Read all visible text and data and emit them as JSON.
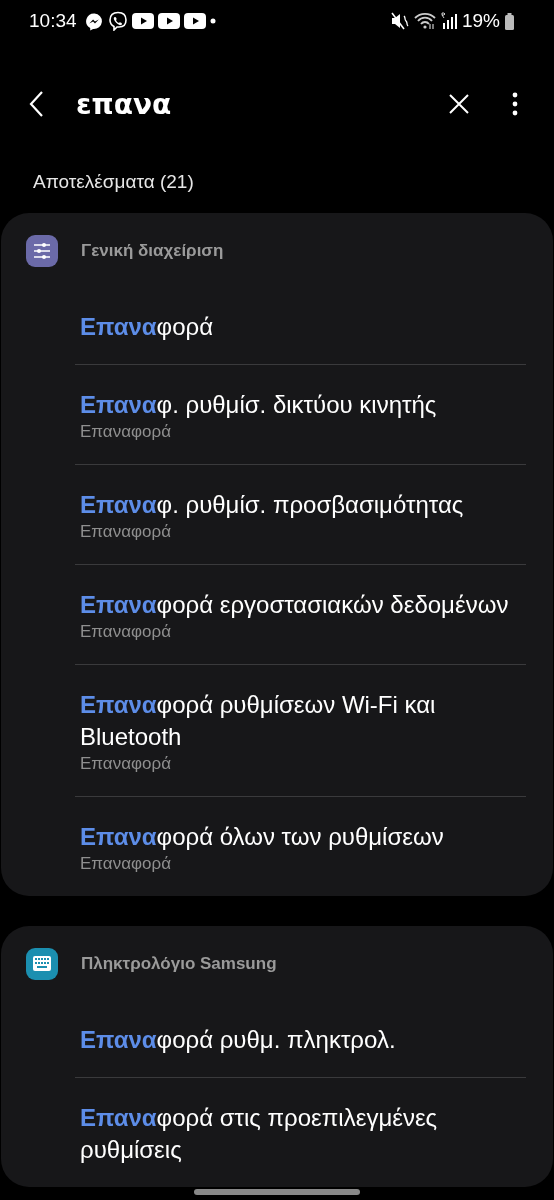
{
  "status_bar": {
    "time": "10:34",
    "battery": "19%"
  },
  "search": {
    "value": "επανα"
  },
  "results_label": "Αποτελέσματα (21)",
  "groups": [
    {
      "title": "Γενική διαχείριση",
      "items": [
        {
          "title": "**Επανα**φορά"
        },
        {
          "title": "**Επανα**φ. ρυθμίσ. δικτύου κινητής",
          "subtitle": "Επαναφορά"
        },
        {
          "title": "**Επανα**φ. ρυθμίσ. προσβασιμότητας",
          "subtitle": "Επαναφορά"
        },
        {
          "title": "**Επανα**φορά εργοστασιακών δεδομένων",
          "subtitle": "Επαναφορά"
        },
        {
          "title": "**Επανα**φορά ρυθμίσεων Wi-Fi και Bluetooth",
          "subtitle": "Επαναφορά"
        },
        {
          "title": "**Επανα**φορά όλων των ρυθμίσεων",
          "subtitle": "Επαναφορά"
        }
      ]
    },
    {
      "title": "Πληκτρολόγιο Samsung",
      "items": [
        {
          "title": "**Επανα**φορά ρυθμ. πληκτρολ."
        },
        {
          "title": "**Επανα**φορά στις προεπιλεγμένες ρυθμίσεις"
        }
      ]
    }
  ]
}
